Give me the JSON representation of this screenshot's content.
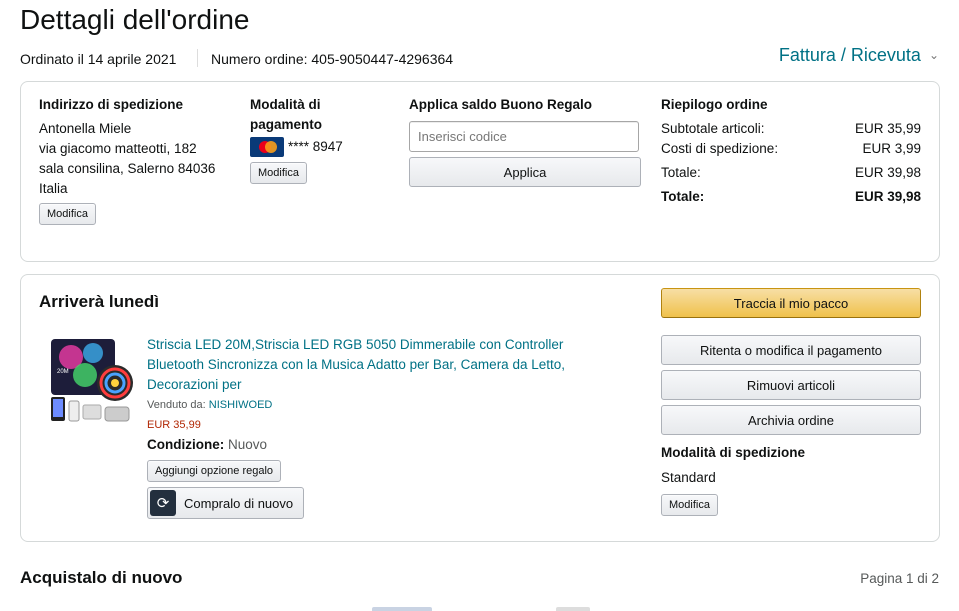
{
  "page": {
    "title": "Dettagli dell'ordine",
    "ordered_on": "Ordinato il 14 aprile 2021",
    "order_number": "Numero ordine: 405-9050447-4296364",
    "invoice_link": "Fattura / Ricevuta"
  },
  "shipping": {
    "heading": "Indirizzo di spedizione",
    "name": "Antonella Miele",
    "line1": "via giacomo matteotti, 182",
    "line2": "sala consilina, Salerno 84036",
    "country": "Italia",
    "edit": "Modifica"
  },
  "payment": {
    "heading_line1": "Modalità di",
    "heading_line2": "pagamento",
    "card_brand": "MasterCard",
    "card_number": "**** 8947",
    "edit": "Modifica"
  },
  "gift": {
    "heading": "Applica saldo Buono Regalo",
    "placeholder": "Inserisci codice",
    "apply": "Applica"
  },
  "summary": {
    "heading": "Riepilogo ordine",
    "subtotal_label": "Subtotale articoli:",
    "subtotal_value": "EUR 35,99",
    "shipping_label": "Costi di spedizione:",
    "shipping_value": "EUR 3,99",
    "total_label": "Totale:",
    "total_value": "EUR 39,98",
    "grand_label": "Totale:",
    "grand_value": "EUR 39,98"
  },
  "shipment": {
    "arrival": "Arriverà lunedì",
    "product_title_1": "Striscia LED 20M,Striscia LED RGB 5050 Dimmerabile con Controller",
    "product_title_2": "Bluetooth Sincronizza con la Musica Adatto per Bar, Camera da Letto,",
    "product_title_3": "Decorazioni per",
    "sold_by_label": "Venduto da:",
    "seller": "NISHIWOED",
    "price": "EUR 35,99",
    "condition_label": "Condizione:",
    "condition_value": "Nuovo",
    "gift_option": "Aggiungi opzione regalo",
    "buy_again": "Compralo di nuovo",
    "track": "Traccia il mio pacco",
    "retry_payment": "Ritenta o modifica il pagamento",
    "remove_items": "Rimuovi articoli",
    "archive": "Archivia ordine",
    "shipping_method_heading": "Modalità di spedizione",
    "shipping_method": "Standard",
    "edit": "Modifica"
  },
  "buy_again_section": {
    "heading": "Acquistalo di nuovo",
    "pagination": "Pagina 1 di 2"
  },
  "colors": {
    "link": "#007185",
    "price": "#b12704",
    "track_button": "#f0c14b"
  }
}
